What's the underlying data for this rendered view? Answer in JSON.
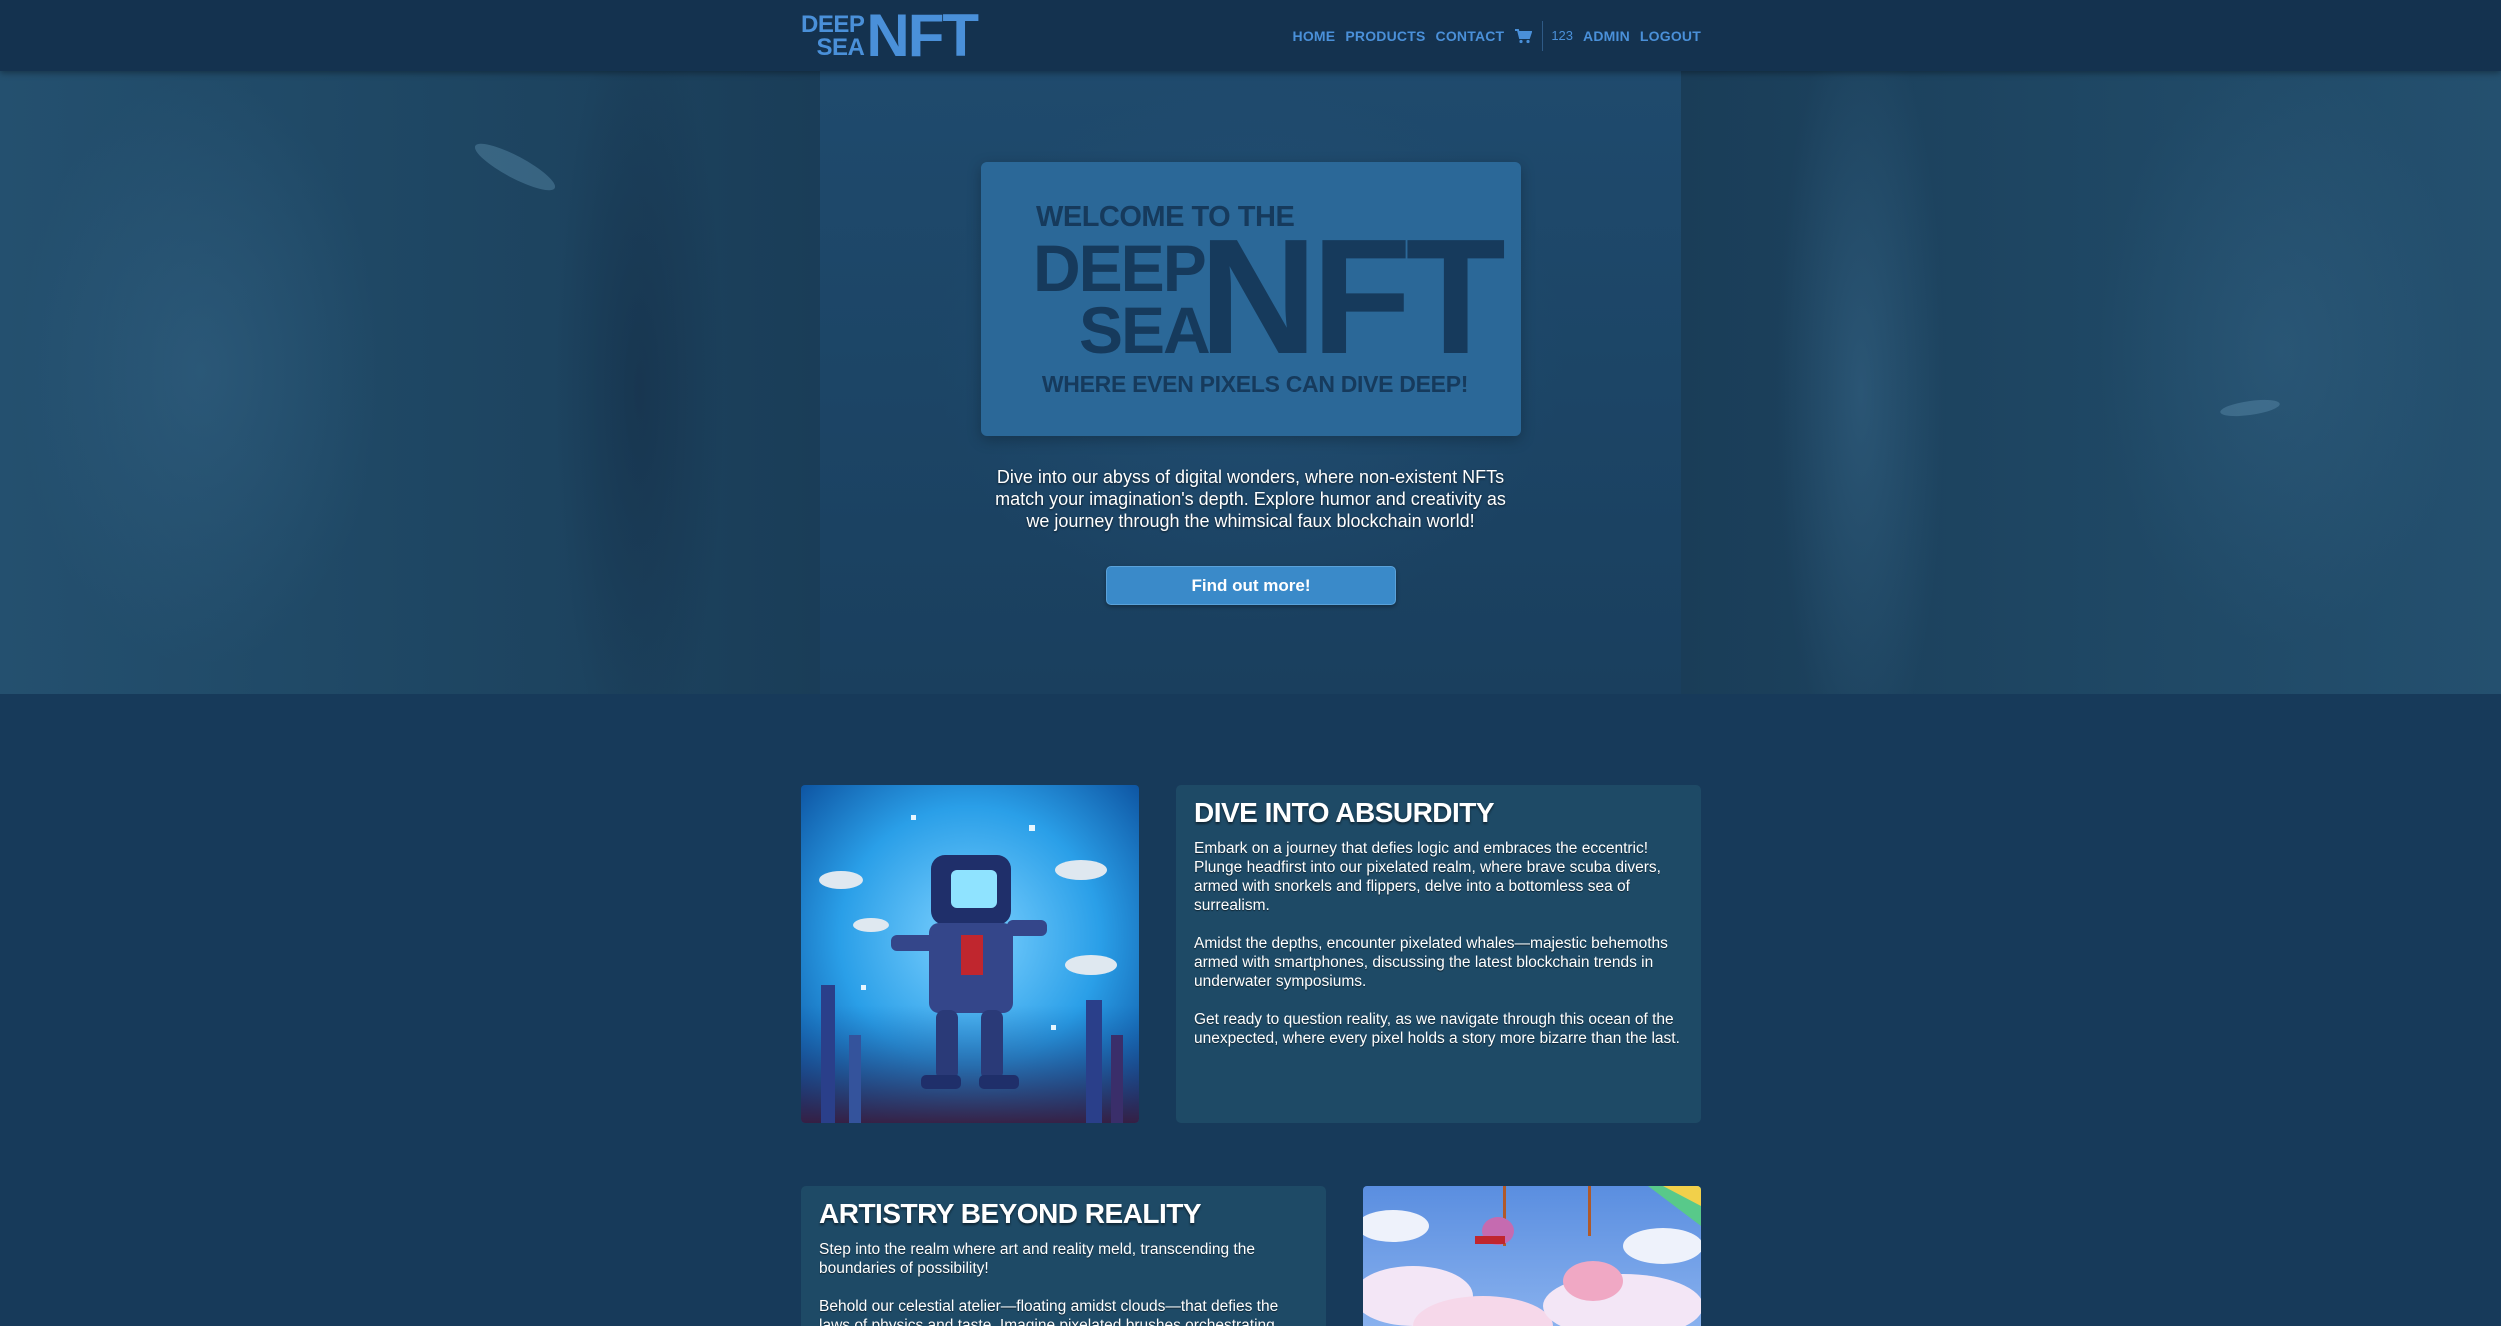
{
  "brand": {
    "small_top": "DEEP",
    "small_bottom": "SEA",
    "big": "NFT"
  },
  "nav": {
    "home": "HOME",
    "products": "PRODUCTS",
    "contact": "CONTACT",
    "cart_icon": "cart-icon",
    "user_number": "123",
    "admin": "ADMIN",
    "logout": "LOGOUT"
  },
  "hero": {
    "welcome": "WELCOME TO THE",
    "deep": "DEEP",
    "sea": "SEA",
    "nft": "NFT",
    "tagline": "WHERE EVEN PIXELS CAN DIVE DEEP!",
    "description": "Dive into our abyss of digital wonders, where non-existent NFTs match your imagination's depth. Explore humor and creativity as we journey through the whimsical faux blockchain world!",
    "button": "Find out more!"
  },
  "sections": [
    {
      "title": "DIVE INTO ABSURDITY",
      "paragraphs": [
        "Embark on a journey that defies logic and embraces the eccentric! Plunge headfirst into our pixelated realm, where brave scuba divers, armed with snorkels and flippers, delve into a bottomless sea of surrealism.",
        "Amidst the depths, encounter pixelated whales—majestic behemoths armed with smartphones, discussing the latest blockchain trends in underwater symposiums.",
        "Get ready to question reality, as we navigate through this ocean of the unexpected, where every pixel holds a story more bizarre than the last."
      ]
    },
    {
      "title": "ARTISTRY BEYOND REALITY",
      "paragraphs": [
        "Step into the realm where art and reality meld, transcending the boundaries of possibility!",
        "Behold our celestial atelier—floating amidst clouds—that defies the laws of physics and taste. Imagine pixelated brushes orchestrating"
      ]
    }
  ],
  "colors": {
    "accent": "#4a90d9",
    "nav_bg": "#14324f",
    "page_bg": "#173a5a",
    "hero_card": "#2b6898",
    "hero_text": "#163a5c",
    "button": "#3a8ac9",
    "section_card": "#1e4a66"
  }
}
